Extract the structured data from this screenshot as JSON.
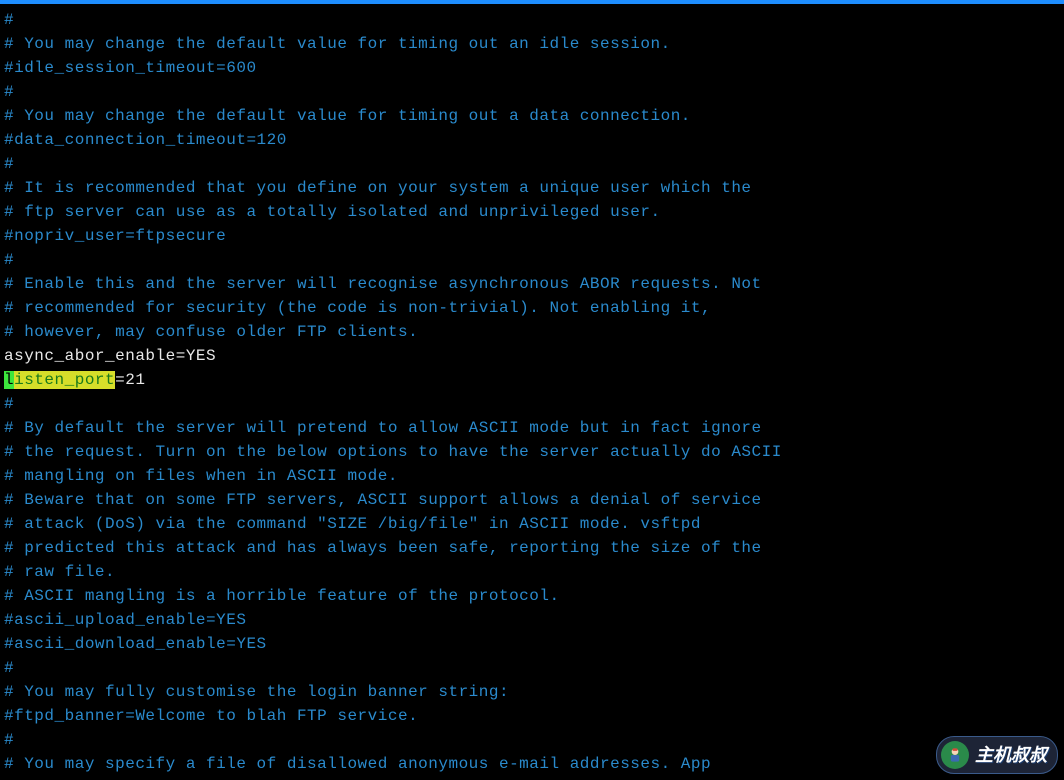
{
  "lines": [
    {
      "cls": "comment",
      "t": "#"
    },
    {
      "cls": "comment",
      "t": "# You may change the default value for timing out an idle session."
    },
    {
      "cls": "comment",
      "t": "#idle_session_timeout=600"
    },
    {
      "cls": "comment",
      "t": "#"
    },
    {
      "cls": "comment",
      "t": "# You may change the default value for timing out a data connection."
    },
    {
      "cls": "comment",
      "t": "#data_connection_timeout=120"
    },
    {
      "cls": "comment",
      "t": "#"
    },
    {
      "cls": "comment",
      "t": "# It is recommended that you define on your system a unique user which the"
    },
    {
      "cls": "comment",
      "t": "# ftp server can use as a totally isolated and unprivileged user."
    },
    {
      "cls": "comment",
      "t": "#nopriv_user=ftpsecure"
    },
    {
      "cls": "comment",
      "t": "#"
    },
    {
      "cls": "comment",
      "t": "# Enable this and the server will recognise asynchronous ABOR requests. Not"
    },
    {
      "cls": "comment",
      "t": "# recommended for security (the code is non-trivial). Not enabling it,"
    },
    {
      "cls": "comment",
      "t": "# however, may confuse older FTP clients."
    },
    {
      "cls": "plain",
      "t": "async_abor_enable=YES"
    },
    {
      "cls": "highlight",
      "cursor": "l",
      "key": "isten_port",
      "rest": "=21"
    },
    {
      "cls": "comment",
      "t": "#"
    },
    {
      "cls": "comment",
      "t": "# By default the server will pretend to allow ASCII mode but in fact ignore"
    },
    {
      "cls": "comment",
      "t": "# the request. Turn on the below options to have the server actually do ASCII"
    },
    {
      "cls": "comment",
      "t": "# mangling on files when in ASCII mode."
    },
    {
      "cls": "comment",
      "t": "# Beware that on some FTP servers, ASCII support allows a denial of service"
    },
    {
      "cls": "comment",
      "t": "# attack (DoS) via the command \"SIZE /big/file\" in ASCII mode. vsftpd"
    },
    {
      "cls": "comment",
      "t": "# predicted this attack and has always been safe, reporting the size of the"
    },
    {
      "cls": "comment",
      "t": "# raw file."
    },
    {
      "cls": "comment",
      "t": "# ASCII mangling is a horrible feature of the protocol."
    },
    {
      "cls": "comment",
      "t": "#ascii_upload_enable=YES"
    },
    {
      "cls": "comment",
      "t": "#ascii_download_enable=YES"
    },
    {
      "cls": "comment",
      "t": "#"
    },
    {
      "cls": "comment",
      "t": "# You may fully customise the login banner string:"
    },
    {
      "cls": "comment",
      "t": "#ftpd_banner=Welcome to blah FTP service."
    },
    {
      "cls": "comment",
      "t": "#"
    },
    {
      "cls": "comment",
      "t": "# You may specify a file of disallowed anonymous e-mail addresses. App"
    }
  ],
  "watermark": {
    "label": "主机叔叔"
  }
}
